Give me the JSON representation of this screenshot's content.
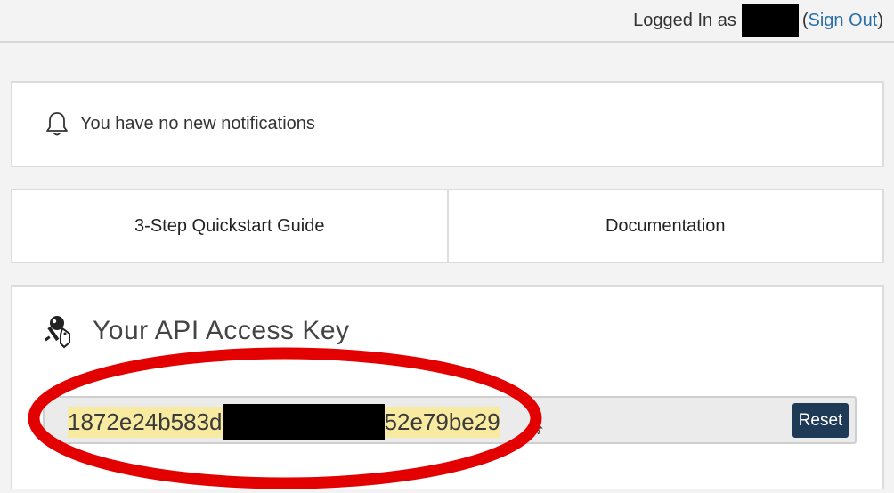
{
  "header": {
    "logged_in_label": "Logged In as",
    "sign_out_label": "Sign Out",
    "open_paren": "(",
    "close_paren": ")"
  },
  "notifications": {
    "message": "You have no new notifications",
    "icon": "bell-icon"
  },
  "links": {
    "quickstart_label": "3-Step Quickstart Guide",
    "documentation_label": "Documentation"
  },
  "api_key": {
    "title": "Your API Access Key",
    "icon": "key-icon",
    "key_prefix": "1872e24b583d",
    "key_suffix": "52e79be29",
    "reset_label": "Reset"
  },
  "colors": {
    "link": "#2a6fa8",
    "reset_button_bg": "#1f3a56",
    "key_highlight": "#f8eaa0",
    "annotation": "#e30000"
  }
}
